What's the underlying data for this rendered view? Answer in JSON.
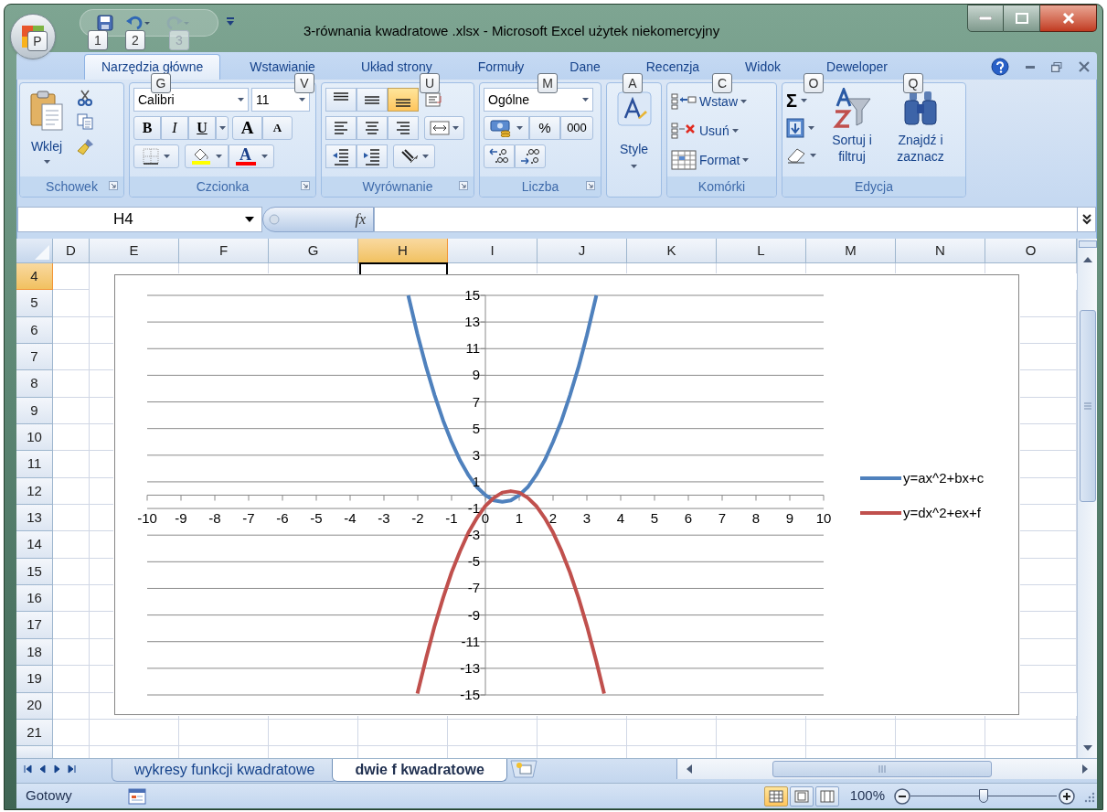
{
  "window": {
    "title": "3-równania kwadratowe .xlsx - Microsoft Excel użytek niekomercyjny"
  },
  "key_tips": [
    {
      "label": "P",
      "disabled": false
    },
    {
      "label": "1",
      "disabled": false
    },
    {
      "label": "2",
      "disabled": false
    },
    {
      "label": "3",
      "disabled": true
    },
    {
      "label": "G",
      "disabled": false
    },
    {
      "label": "V",
      "disabled": false
    },
    {
      "label": "U",
      "disabled": false
    },
    {
      "label": "M",
      "disabled": false
    },
    {
      "label": "A",
      "disabled": false
    },
    {
      "label": "C",
      "disabled": false
    },
    {
      "label": "O",
      "disabled": false
    },
    {
      "label": "Q",
      "disabled": false
    }
  ],
  "ribbon_tabs": [
    {
      "label": "Narzędzia główne",
      "selected": true
    },
    {
      "label": "Wstawianie",
      "selected": false
    },
    {
      "label": "Układ strony",
      "selected": false
    },
    {
      "label": "Formuły",
      "selected": false
    },
    {
      "label": "Dane",
      "selected": false
    },
    {
      "label": "Recenzja",
      "selected": false
    },
    {
      "label": "Widok",
      "selected": false
    },
    {
      "label": "Deweloper",
      "selected": false
    }
  ],
  "clipboard": {
    "paste": "Wklej",
    "label": "Schowek"
  },
  "font": {
    "name": "Calibri",
    "size": "11",
    "bold": "B",
    "italic": "I",
    "underline": "U",
    "grow": "A",
    "shrink": "A",
    "font_color_button": "A",
    "label": "Czcionka"
  },
  "alignment": {
    "label": "Wyrównanie",
    "vertical": [
      {
        "kind": "top",
        "selected": false
      },
      {
        "kind": "middle",
        "selected": false
      },
      {
        "kind": "bottom",
        "selected": true
      }
    ]
  },
  "number": {
    "format": "Ogólne",
    "percent": "%",
    "thousands": "000",
    "label": "Liczba"
  },
  "styles": {
    "button": "Style"
  },
  "cells": {
    "buttons": [
      "Wstaw",
      "Usuń",
      "Format"
    ],
    "label": "Komórki"
  },
  "editing": {
    "sum": "Σ",
    "sort": "Sortuj i filtruj",
    "find": "Znajdź i zaznacz",
    "label": "Edycja"
  },
  "formula_bar": {
    "name_box": "H4",
    "function_label": "fx"
  },
  "columns": [
    {
      "label": "D",
      "selected": false
    },
    {
      "label": "E",
      "selected": false
    },
    {
      "label": "F",
      "selected": false
    },
    {
      "label": "G",
      "selected": false
    },
    {
      "label": "H",
      "selected": true
    },
    {
      "label": "I",
      "selected": false
    },
    {
      "label": "J",
      "selected": false
    },
    {
      "label": "K",
      "selected": false
    },
    {
      "label": "L",
      "selected": false
    },
    {
      "label": "M",
      "selected": false
    },
    {
      "label": "N",
      "selected": false
    },
    {
      "label": "O",
      "selected": false
    }
  ],
  "rows": [
    {
      "label": "4",
      "selected": true
    },
    {
      "label": "5",
      "selected": false
    },
    {
      "label": "6",
      "selected": false
    },
    {
      "label": "7",
      "selected": false
    },
    {
      "label": "8",
      "selected": false
    },
    {
      "label": "9",
      "selected": false
    },
    {
      "label": "10",
      "selected": false
    },
    {
      "label": "11",
      "selected": false
    },
    {
      "label": "12",
      "selected": false
    },
    {
      "label": "13",
      "selected": false
    },
    {
      "label": "14",
      "selected": false
    },
    {
      "label": "15",
      "selected": false
    },
    {
      "label": "16",
      "selected": false
    },
    {
      "label": "17",
      "selected": false
    },
    {
      "label": "18",
      "selected": false
    },
    {
      "label": "19",
      "selected": false
    },
    {
      "label": "20",
      "selected": false
    },
    {
      "label": "21",
      "selected": false
    }
  ],
  "chart": {
    "chart_data": {
      "type": "line",
      "x": [
        -2.28,
        -2.01,
        -1.75,
        -1.5,
        -1.25,
        -1,
        -0.75,
        -0.5,
        -0.25,
        0,
        0.25,
        0.5,
        0.75,
        1,
        1.25,
        1.5,
        1.75,
        2,
        2.25,
        2.5,
        2.75,
        3,
        3.28,
        3.51
      ],
      "series": [
        {
          "name": "y=ax^2+bx+c",
          "color": "#4f81bd",
          "values": [
            15,
            12.1,
            9.6,
            7.5,
            5.6,
            4,
            2.6,
            1.5,
            0.6,
            0,
            -0.4,
            -0.5,
            -0.4,
            0,
            0.6,
            1.5,
            2.6,
            4,
            5.6,
            7.5,
            9.6,
            12,
            15,
            null
          ]
        },
        {
          "name": "y=dx^2+ex+f",
          "color": "#c0504d",
          "values": [
            null,
            -14.9,
            -12.2,
            -9.8,
            -7.7,
            -5.8,
            -4.2,
            -2.8,
            -1.7,
            -0.8,
            -0.2,
            0.2,
            0.3,
            0.2,
            -0.2,
            -0.8,
            -1.7,
            -2.8,
            -4.2,
            -5.8,
            -7.7,
            -9.8,
            -12.5,
            -14.9
          ]
        }
      ],
      "xlim": [
        -10,
        10
      ],
      "ylim": [
        -15,
        15
      ],
      "xticks": [
        {
          "value": -10,
          "label": "-10"
        },
        {
          "value": -9,
          "label": "-9"
        },
        {
          "value": -8,
          "label": "-8"
        },
        {
          "value": -7,
          "label": "-7"
        },
        {
          "value": -6,
          "label": "-6"
        },
        {
          "value": -5,
          "label": "-5"
        },
        {
          "value": -4,
          "label": "-4"
        },
        {
          "value": -3,
          "label": "-3"
        },
        {
          "value": -2,
          "label": "-2"
        },
        {
          "value": -1,
          "label": "-1"
        },
        {
          "value": 0,
          "label": "0"
        },
        {
          "value": 1,
          "label": "1"
        },
        {
          "value": 2,
          "label": "2"
        },
        {
          "value": 3,
          "label": "3"
        },
        {
          "value": 4,
          "label": "4"
        },
        {
          "value": 5,
          "label": "5"
        },
        {
          "value": 6,
          "label": "6"
        },
        {
          "value": 7,
          "label": "7"
        },
        {
          "value": 8,
          "label": "8"
        },
        {
          "value": 9,
          "label": "9"
        },
        {
          "value": 10,
          "label": "10"
        }
      ],
      "yticks": [
        {
          "value": 15,
          "label": "15"
        },
        {
          "value": 13,
          "label": "13"
        },
        {
          "value": 11,
          "label": "11"
        },
        {
          "value": 9,
          "label": "9"
        },
        {
          "value": 7,
          "label": "7"
        },
        {
          "value": 5,
          "label": "5"
        },
        {
          "value": 3,
          "label": "3"
        },
        {
          "value": 1,
          "label": "1"
        },
        {
          "value": -1,
          "label": "-1"
        },
        {
          "value": -3,
          "label": "-3"
        },
        {
          "value": -5,
          "label": "-5"
        },
        {
          "value": -7,
          "label": "-7"
        },
        {
          "value": -9,
          "label": "-9"
        },
        {
          "value": -11,
          "label": "-11"
        },
        {
          "value": -13,
          "label": "-13"
        },
        {
          "value": -15,
          "label": "-15"
        }
      ],
      "grid": true,
      "legend": true
    }
  },
  "sheet_tabs": [
    {
      "label": "wykresy funkcji kwadratowe",
      "selected": false
    },
    {
      "label": "dwie f kwadratowe",
      "selected": true
    }
  ],
  "status_bar": {
    "text": "Gotowy",
    "zoom": "100%",
    "zoom_slider": {
      "level": 0.5
    }
  }
}
